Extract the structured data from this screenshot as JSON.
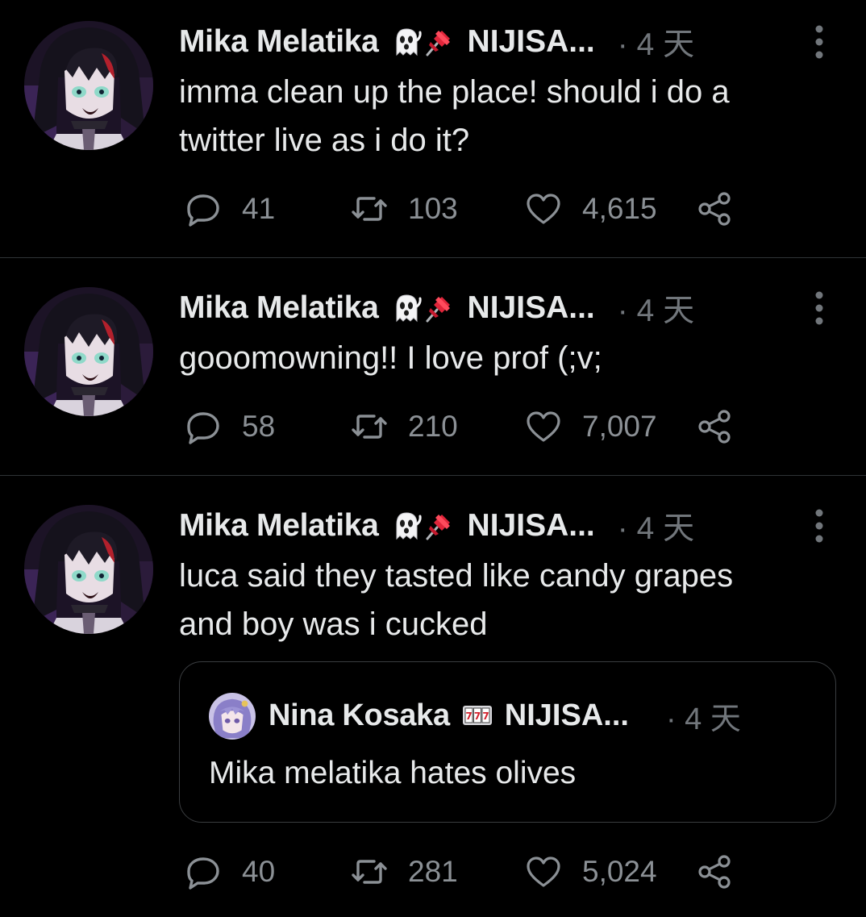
{
  "accent_colors": {
    "background": "#000000",
    "primary_text": "#e7e9ea",
    "secondary_text": "#71767b",
    "divider": "#2f3336"
  },
  "tweets": [
    {
      "author": {
        "display_name": "Mika Melatika",
        "badges": [
          "ghost-emoji",
          "pushpin-emoji"
        ],
        "org": "NIJISA...",
        "avatar": "avatar-mika"
      },
      "time": "· 4 天",
      "text": "imma clean up the place! should i do a twitter live as i do it?",
      "text_lines": [
        "imma clean up the place! should i do a",
        "twitter live as i do it?"
      ],
      "replies": "41",
      "retweets": "103",
      "likes": "4,615"
    },
    {
      "author": {
        "display_name": "Mika Melatika",
        "badges": [
          "ghost-emoji",
          "pushpin-emoji"
        ],
        "org": "NIJISA...",
        "avatar": "avatar-mika"
      },
      "time": "· 4 天",
      "text": "gooomowning!! I love prof (;v;",
      "text_lines": [
        "gooomowning!! I love prof (;v;"
      ],
      "replies": "58",
      "retweets": "210",
      "likes": "7,007"
    },
    {
      "author": {
        "display_name": "Mika Melatika",
        "badges": [
          "ghost-emoji",
          "pushpin-emoji"
        ],
        "org": "NIJISA...",
        "avatar": "avatar-mika"
      },
      "time": "· 4 天",
      "text": "luca said they tasted like candy grapes and boy was i cucked",
      "text_lines": [
        "luca said they tasted like candy grapes",
        "and boy was i cucked"
      ],
      "replies": "40",
      "retweets": "281",
      "likes": "5,024",
      "quoted_tweet": {
        "author": {
          "display_name": "Nina Kosaka",
          "badges": [
            "slot-machine-777-emoji"
          ],
          "org": "NIJISA...",
          "avatar": "avatar-nina"
        },
        "time": "· 4 天",
        "text": "Mika melatika hates olives"
      }
    }
  ]
}
